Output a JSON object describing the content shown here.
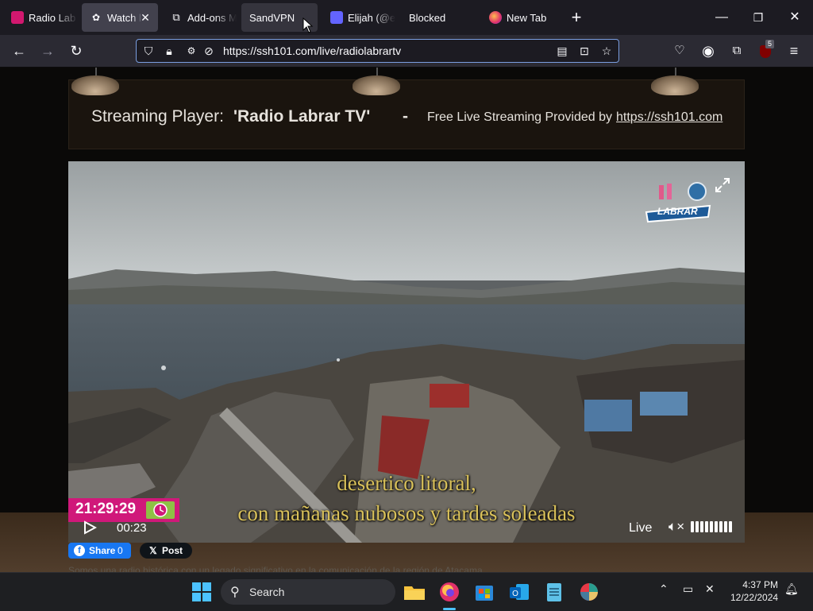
{
  "browser": {
    "tabs": [
      {
        "label": "Radio Lab",
        "active": false
      },
      {
        "label": "Watch l",
        "active": true
      },
      {
        "label": "Add-ons M",
        "active": false
      },
      {
        "label": "SandVPN",
        "active": false
      },
      {
        "label": "Elijah (@el",
        "active": false
      },
      {
        "label": "Blocked",
        "active": false
      },
      {
        "label": "New Tab",
        "active": false
      }
    ],
    "url": "https://ssh101.com/live/radiolabrartv",
    "extension_badge": "5"
  },
  "page": {
    "header": {
      "player_label": "Streaming Player:",
      "station": "'Radio Labrar TV'",
      "dash": "-",
      "provided_by": "Free Live Streaming Provided by",
      "link": "https://ssh101.com"
    },
    "video": {
      "caption_line1": "desertico litoral,",
      "caption_line2": "con mañanas nubosos y tardes soleadas",
      "clock_time": "21:29:29",
      "elapsed": "00:23",
      "live_label": "Live",
      "logo_text": "LABRAR"
    },
    "social": {
      "share_label": "Share",
      "share_count": "0",
      "post_label": "Post"
    },
    "description": "Somos una radio histórica con un legado significativo en la comunicación de la región de Atacama"
  },
  "taskbar": {
    "search_placeholder": "Search",
    "time": "4:37 PM",
    "date": "12/22/2024"
  },
  "colors": {
    "accent": "#d0187a",
    "url_focus": "#7a9ee0",
    "caption": "#d9c15a"
  }
}
